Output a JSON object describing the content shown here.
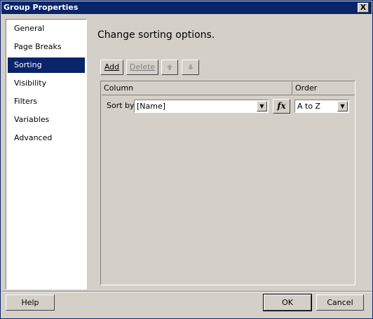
{
  "window": {
    "title": "Group Properties",
    "close_label": "X"
  },
  "nav": {
    "items": [
      {
        "label": "General"
      },
      {
        "label": "Page Breaks"
      },
      {
        "label": "Sorting"
      },
      {
        "label": "Visibility"
      },
      {
        "label": "Filters"
      },
      {
        "label": "Variables"
      },
      {
        "label": "Advanced"
      }
    ],
    "selected": "Sorting"
  },
  "main": {
    "title": "Change sorting options.",
    "toolbar": {
      "add_label": "Add",
      "delete_label": "Delete",
      "move_up_icon": "arrow-up-icon",
      "move_down_icon": "arrow-down-icon"
    },
    "grid": {
      "columns": [
        "Column",
        "Order"
      ],
      "rows": [
        {
          "row_label": "Sort by",
          "column_value": "[Name]",
          "expression_icon": "fx",
          "order_value": "A to Z"
        }
      ]
    }
  },
  "footer": {
    "help_label": "Help",
    "ok_label": "OK",
    "cancel_label": "Cancel"
  },
  "colors": {
    "titlebar": "#0a246a",
    "selection": "#0a246a",
    "dialog_bg": "#d4d0c8"
  }
}
